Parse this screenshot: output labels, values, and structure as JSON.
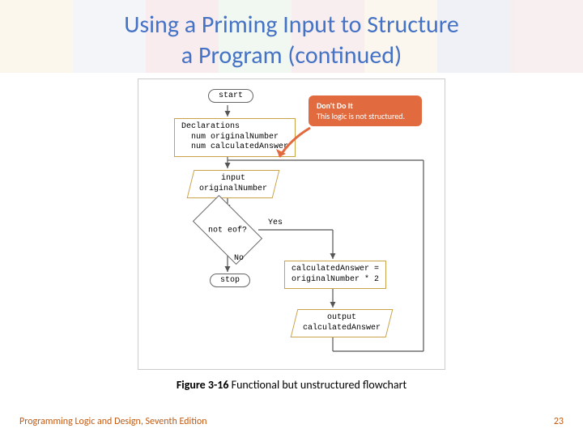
{
  "title_line1": "Using a Priming Input to Structure",
  "title_line2": "a Program (continued)",
  "flow": {
    "start": "start",
    "declarations": "Declarations\n  num originalNumber\n  num calculatedAnswer",
    "input": "input\noriginalNumber",
    "decision": "not eof?",
    "yes": "Yes",
    "no": "No",
    "stop": "stop",
    "calc": "calculatedAnswer =\noriginalNumber * 2",
    "output": "output\ncalculatedAnswer"
  },
  "callout": {
    "header": "Don't Do It",
    "body": "This logic is not structured."
  },
  "caption_bold": "Figure 3-16",
  "caption_rest": " Functional but unstructured flowchart",
  "footer_left": "Programming Logic and Design, Seventh Edition",
  "footer_right": "23"
}
